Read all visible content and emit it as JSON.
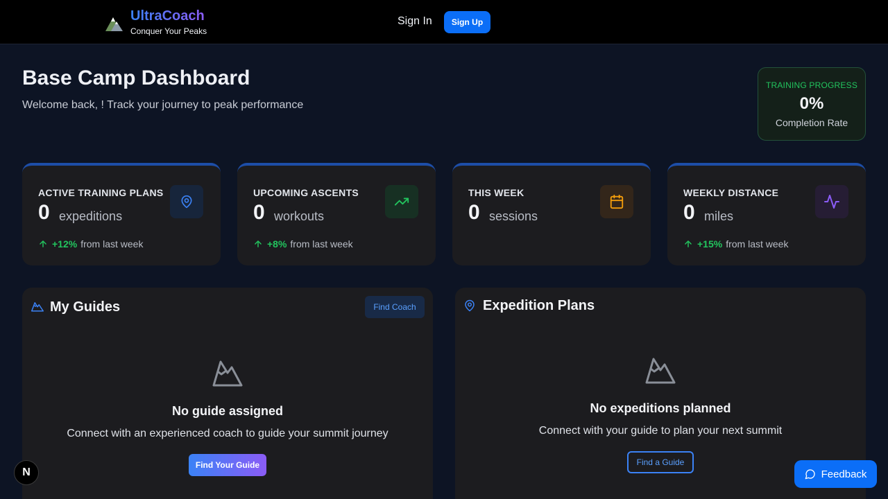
{
  "header": {
    "brand_name": "UltraCoach",
    "brand_tagline": "Conquer Your Peaks",
    "sign_in": "Sign In",
    "sign_up": "Sign Up"
  },
  "page": {
    "title": "Base Camp Dashboard",
    "subtitle": "Welcome back, ! Track your journey to peak performance"
  },
  "progress": {
    "label": "TRAINING PROGRESS",
    "value": "0%",
    "caption": "Completion Rate"
  },
  "stats": [
    {
      "label": "ACTIVE TRAINING PLANS",
      "value": "0",
      "unit": "expeditions",
      "trend_pct": "+12%",
      "trend_text": "from last week",
      "icon": "map-pin-icon"
    },
    {
      "label": "UPCOMING ASCENTS",
      "value": "0",
      "unit": "workouts",
      "trend_pct": "+8%",
      "trend_text": "from last week",
      "icon": "trending-up-icon"
    },
    {
      "label": "THIS WEEK",
      "value": "0",
      "unit": "sessions",
      "icon": "calendar-icon"
    },
    {
      "label": "WEEKLY DISTANCE",
      "value": "0",
      "unit": "miles",
      "trend_pct": "+15%",
      "trend_text": "from last week",
      "icon": "activity-icon"
    }
  ],
  "guides": {
    "title": "My Guides",
    "find_coach": "Find Coach",
    "empty_title": "No guide assigned",
    "empty_desc": "Connect with an experienced coach to guide your summit journey",
    "cta": "Find Your Guide"
  },
  "expeditions": {
    "title": "Expedition Plans",
    "empty_title": "No expeditions planned",
    "empty_desc": "Connect with your guide to plan your next summit",
    "cta": "Find a Guide"
  },
  "floating": {
    "badge": "N",
    "feedback": "Feedback"
  },
  "colors": {
    "accent": "#0b6ef7",
    "success": "#22c55e",
    "gradient_start": "#3b82f6",
    "gradient_end": "#8b5cf6"
  }
}
